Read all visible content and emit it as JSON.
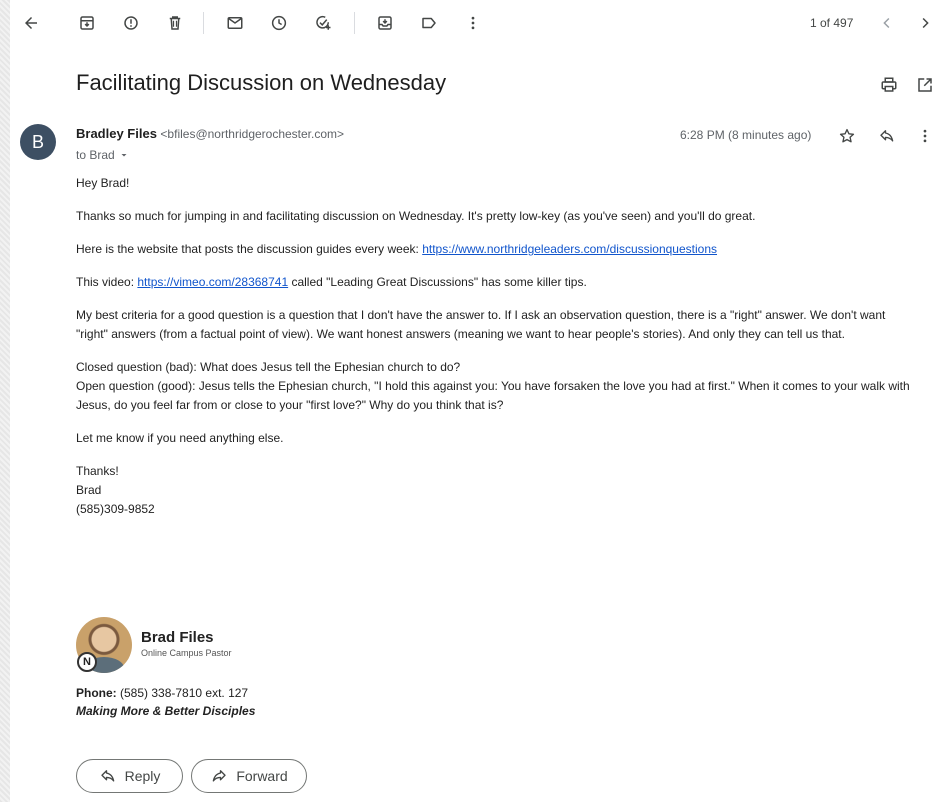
{
  "toolbar": {
    "page_count": "1 of 497"
  },
  "email": {
    "subject": "Facilitating Discussion on Wednesday",
    "avatar_letter": "B",
    "sender_name": "Bradley Files",
    "sender_email": "<bfiles@northridgerochester.com>",
    "to_label": "to Brad",
    "time": "6:28 PM (8 minutes ago)",
    "body": {
      "greeting": "Hey Brad!",
      "p1": "Thanks so much for jumping in and facilitating discussion on Wednesday.  It's pretty low-key (as you've seen) and you'll do great.",
      "p2_prefix": "Here is the website that posts the discussion guides every week: ",
      "p2_link": "https://www.northridgeleaders.com/discussionquestions",
      "p3_prefix": "This video: ",
      "p3_link": "https://vimeo.com/28368741",
      "p3_suffix": " called \"Leading Great Discussions\" has some killer tips.",
      "p4": "My best criteria for a good question is a question that I don't have the answer to.  If I ask an observation question, there is a \"right\" answer.  We don't want \"right\" answers (from a factual point of view).  We want honest answers (meaning we want to hear people's stories).  And only they can tell us that.",
      "p5_line1": "Closed question (bad):  What does Jesus tell the Ephesian church to do?",
      "p5_line2": "Open question (good): Jesus tells the Ephesian church, \"I hold this against you: You have forsaken the love you had at first.\"  When it comes to your walk with Jesus, do you feel far from or close to your \"first love?\"  Why do you think that is?",
      "p6": "Let me know if you need anything else.",
      "closing": "Thanks!",
      "closing_name": "Brad",
      "closing_phone": "(585)309-9852"
    },
    "signature": {
      "logo_letter": "N",
      "name": "Brad Files",
      "title": "Online Campus Pastor",
      "phone_label": "Phone:",
      "phone_value": " (585) 338-7810 ext. 127",
      "tagline": "Making More & Better Disciples"
    }
  },
  "actions": {
    "reply_label": "Reply",
    "forward_label": "Forward"
  },
  "colors": {
    "link": "#1155cc",
    "avatar": "#3d4f63"
  }
}
